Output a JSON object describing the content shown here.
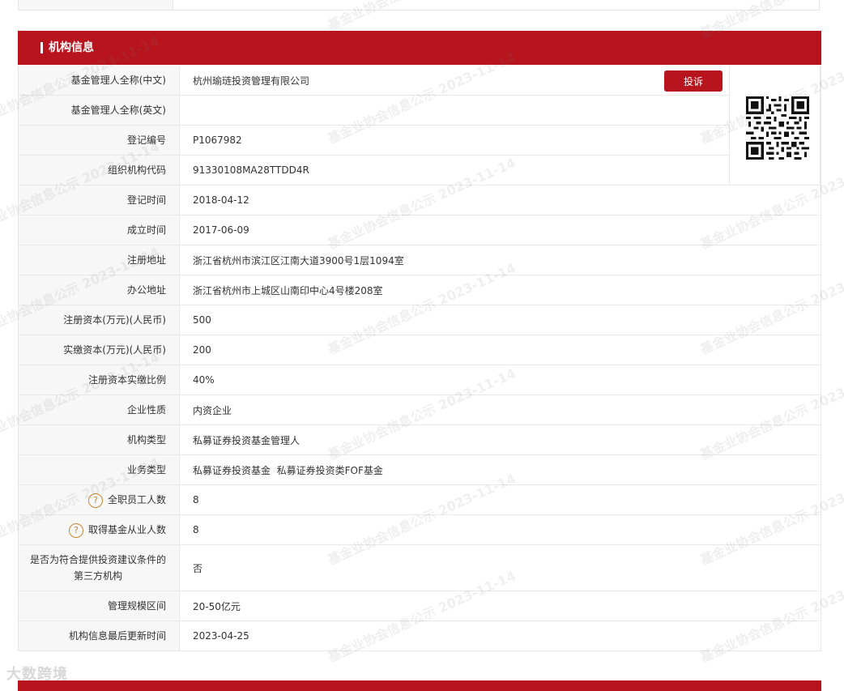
{
  "section": {
    "title": "机构信息"
  },
  "complain_button": "投诉",
  "rows": [
    {
      "label": "基金管理人全称(中文)",
      "value": "杭州瑜琏投资管理有限公司"
    },
    {
      "label": "基金管理人全称(英文)",
      "value": ""
    },
    {
      "label": "登记编号",
      "value": "P1067982"
    },
    {
      "label": "组织机构代码",
      "value": "91330108MA28TTDD4R"
    },
    {
      "label": "登记时间",
      "value": "2018-04-12"
    },
    {
      "label": "成立时间",
      "value": "2017-06-09"
    },
    {
      "label": "注册地址",
      "value": "浙江省杭州市滨江区江南大道3900号1层1094室"
    },
    {
      "label": "办公地址",
      "value": "浙江省杭州市上城区山南印中心4号楼208室"
    },
    {
      "label": "注册资本(万元)(人民币)",
      "value": "500"
    },
    {
      "label": "实缴资本(万元)(人民币)",
      "value": "200"
    },
    {
      "label": "注册资本实缴比例",
      "value": "40%"
    },
    {
      "label": "企业性质",
      "value": "内资企业"
    },
    {
      "label": "机构类型",
      "value": "私募证券投资基金管理人"
    },
    {
      "label": "业务类型",
      "value": "私募证券投资基金  私募证券投资类FOF基金"
    },
    {
      "label": "全职员工人数",
      "value": "8"
    },
    {
      "label": "取得基金从业人数",
      "value": "8"
    },
    {
      "label": "是否为符合提供投资建议条件的第三方机构",
      "value": "否"
    },
    {
      "label": "管理规模区间",
      "value": "20-50亿元"
    },
    {
      "label": "机构信息最后更新时间",
      "value": "2023-04-25"
    }
  ],
  "help_icon_glyph": "?",
  "watermark": "基金业协会信息公示 2023-11-14",
  "logo_text": "大数跨境",
  "icons": {
    "help": "help-circle-icon",
    "qr": "qr-code-icon"
  },
  "colors": {
    "brand_red": "#b7141e",
    "label_bg": "#f7f7f7",
    "help_icon": "#c8862f"
  }
}
